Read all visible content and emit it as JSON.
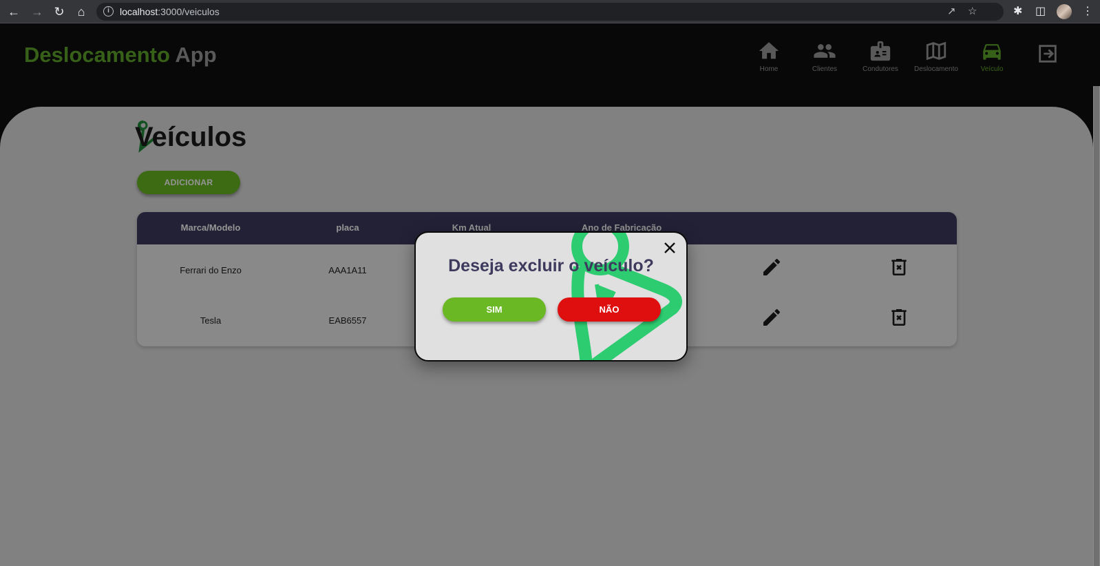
{
  "browser": {
    "url_host": "localhost",
    "url_rest": ":3000/veiculos"
  },
  "header": {
    "brand_primary": "Deslocamento",
    "brand_secondary": "App",
    "brand_primary_color": "#5fa82a",
    "nav": [
      {
        "label": "Home",
        "icon": "home-icon"
      },
      {
        "label": "Clientes",
        "icon": "people-icon"
      },
      {
        "label": "Condutores",
        "icon": "badge-icon"
      },
      {
        "label": "Deslocamento",
        "icon": "map-icon"
      },
      {
        "label": "Veículo",
        "icon": "car-icon",
        "active": true
      },
      {
        "label": "",
        "icon": "logout-icon"
      }
    ]
  },
  "page": {
    "title": "Veículos",
    "add_label": "ADICIONAR"
  },
  "table": {
    "headers": [
      "Marca/Modelo",
      "placa",
      "Km Atual",
      "Ano de Fabricação"
    ],
    "rows": [
      {
        "model": "Ferrari do Enzo",
        "plate": "AAA1A11"
      },
      {
        "model": "Tesla",
        "plate": "EAB6557"
      }
    ]
  },
  "modal": {
    "title": "Deseja excluir o veículo?",
    "yes_label": "SIM",
    "no_label": "NÃO",
    "yes_color": "#6ab824",
    "no_color": "#e00f0f"
  }
}
